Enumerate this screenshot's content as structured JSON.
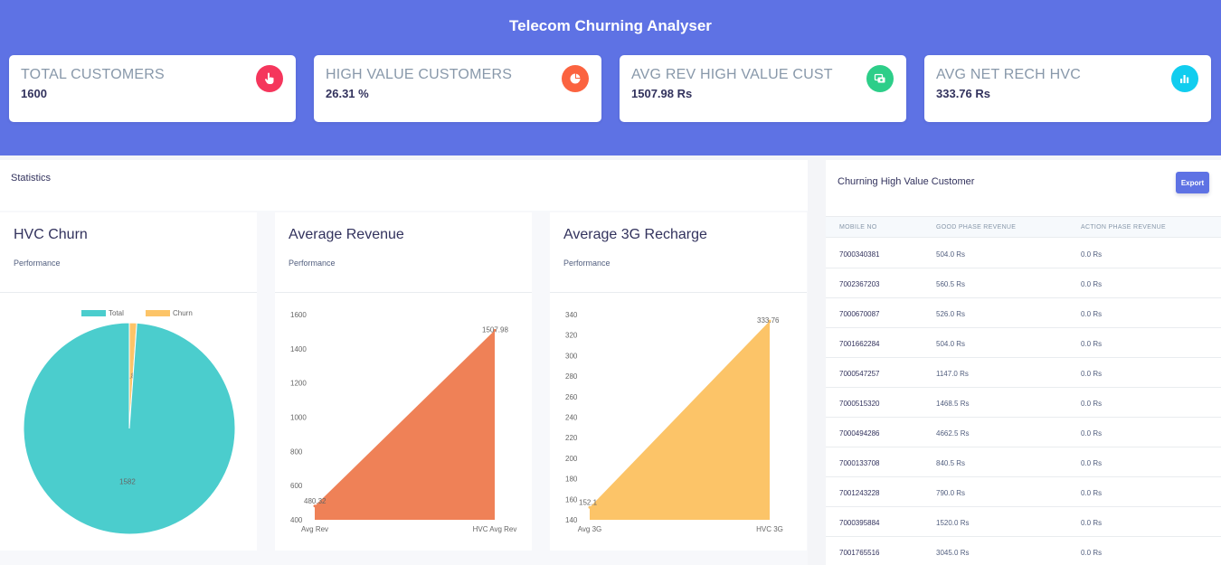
{
  "header": {
    "title": "Telecom Churning Analyser"
  },
  "cards": [
    {
      "title": "TOTAL CUSTOMERS",
      "value": "1600",
      "icon": "hand-pointer-icon",
      "color": "#f5365c"
    },
    {
      "title": "HIGH VALUE CUSTOMERS",
      "value": "26.31 %",
      "icon": "pie-chart-icon",
      "color": "#fb6340"
    },
    {
      "title": "AVG REV HIGH VALUE CUST",
      "value": "1507.98 Rs",
      "icon": "money-icon",
      "color": "#2dce89"
    },
    {
      "title": "AVG NET RECH HVC",
      "value": "333.76 Rs",
      "icon": "bar-chart-icon",
      "color": "#11cdef"
    }
  ],
  "statistics": {
    "title": "Statistics"
  },
  "charts": {
    "churn": {
      "title": "HVC Churn",
      "subtitle": "Performance"
    },
    "revenue": {
      "title": "Average Revenue",
      "subtitle": "Performance"
    },
    "recharge": {
      "title": "Average 3G Recharge",
      "subtitle": "Performance"
    }
  },
  "chart_data": [
    {
      "type": "pie",
      "labels": [
        "Total",
        "Churn"
      ],
      "values": [
        1582,
        18
      ],
      "colors": [
        "#4bcdcd",
        "#fcc468"
      ],
      "legend_position": "top"
    },
    {
      "type": "area",
      "categories": [
        "Avg Rev",
        "HVC Avg Rev"
      ],
      "values": [
        480.32,
        1507.98
      ],
      "data_labels": [
        "480.32",
        "1507.98"
      ],
      "ylim": [
        400,
        1600
      ],
      "yticks": [
        400,
        600,
        800,
        1000,
        1200,
        1400,
        1600
      ],
      "color": "#ef8157"
    },
    {
      "type": "area",
      "categories": [
        "Avg 3G",
        "HVC 3G"
      ],
      "values": [
        152.1,
        333.76
      ],
      "data_labels": [
        "152.1",
        "333.76"
      ],
      "ylim": [
        140,
        340
      ],
      "yticks": [
        140,
        160,
        180,
        200,
        220,
        240,
        260,
        280,
        300,
        320,
        340
      ],
      "color": "#fcc468"
    }
  ],
  "table": {
    "title": "Churning High Value Customer",
    "export_label": "Export",
    "columns": [
      "MOBILE NO",
      "GOOD PHASE REVENUE",
      "ACTION PHASE REVENUE"
    ],
    "rows": [
      [
        "7000340381",
        "504.0 Rs",
        "0.0 Rs"
      ],
      [
        "7002367203",
        "560.5 Rs",
        "0.0 Rs"
      ],
      [
        "7000670087",
        "526.0 Rs",
        "0.0 Rs"
      ],
      [
        "7001662284",
        "504.0 Rs",
        "0.0 Rs"
      ],
      [
        "7000547257",
        "1147.0 Rs",
        "0.0 Rs"
      ],
      [
        "7000515320",
        "1468.5 Rs",
        "0.0 Rs"
      ],
      [
        "7000494286",
        "4662.5 Rs",
        "0.0 Rs"
      ],
      [
        "7000133708",
        "840.5 Rs",
        "0.0 Rs"
      ],
      [
        "7001243228",
        "790.0 Rs",
        "0.0 Rs"
      ],
      [
        "7000395884",
        "1520.0 Rs",
        "0.0 Rs"
      ],
      [
        "7001765516",
        "3045.0 Rs",
        "0.0 Rs"
      ]
    ]
  }
}
